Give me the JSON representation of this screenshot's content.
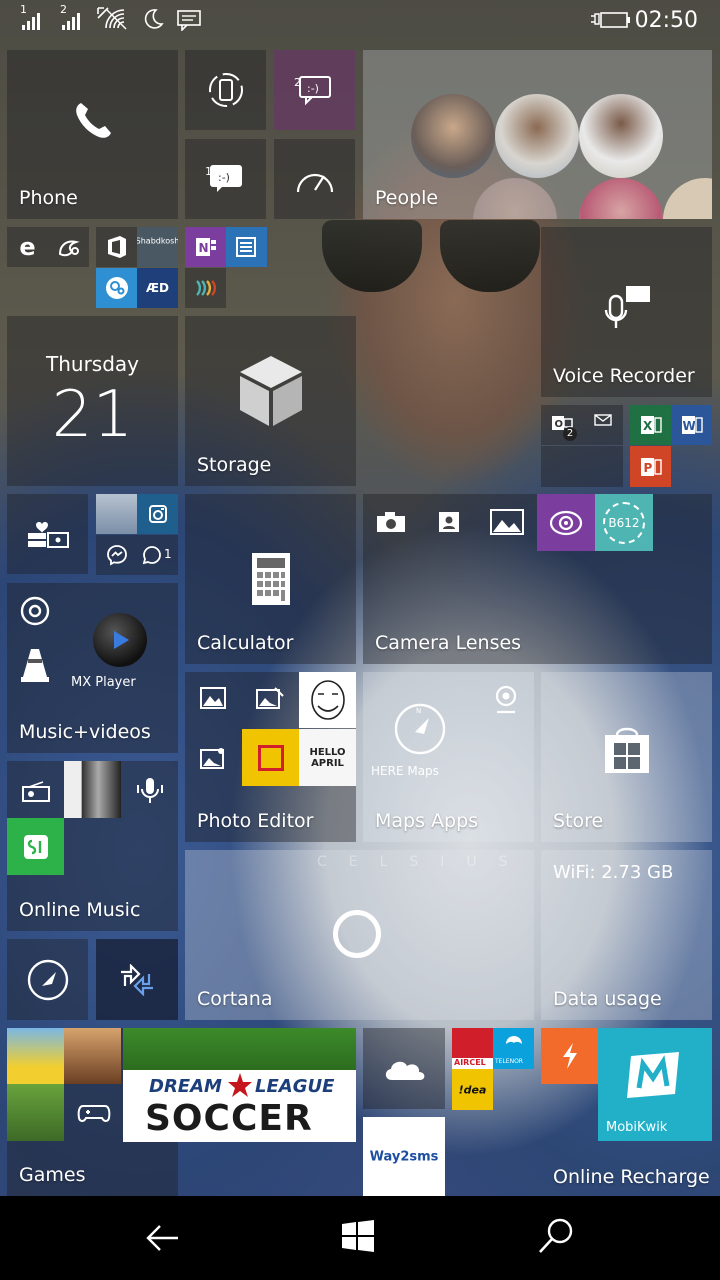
{
  "status_bar": {
    "sim1": "1",
    "sim2": "2",
    "time": "02:50"
  },
  "tiles": {
    "phone": {
      "label": "Phone"
    },
    "messaging_2": {
      "count": "2"
    },
    "messaging_1": {
      "count": "1"
    },
    "people": {
      "label": "People"
    },
    "shabdkosh": {
      "label": "Shabdkosh"
    },
    "aed": {
      "label": "ÆD"
    },
    "calendar": {
      "day_name": "Thursday",
      "day_number": "21"
    },
    "storage": {
      "label": "Storage"
    },
    "voice_recorder": {
      "label": "Voice Recorder"
    },
    "outlook_badge": {
      "count": "2"
    },
    "whatsapp_badge": {
      "count": "1"
    },
    "b612": {
      "label": "B612"
    },
    "calculator": {
      "label": "Calculator"
    },
    "camera_lenses": {
      "label": "Camera Lenses"
    },
    "mx_player": {
      "label": "MX Player"
    },
    "music_videos": {
      "label": "Music+videos"
    },
    "photo_editor": {
      "label": "Photo Editor"
    },
    "hello_april": {
      "label": "HELLO APRIL"
    },
    "maps_apps": {
      "label": "Maps Apps",
      "sub": "HERE Maps"
    },
    "store": {
      "label": "Store"
    },
    "online_music": {
      "label": "Online Music"
    },
    "data_usage": {
      "label": "Data usage",
      "info": "WiFi: 2.73 GB",
      "watermark": "CELSIUS"
    },
    "cortana": {
      "label": "Cortana"
    },
    "games": {
      "label": "Games"
    },
    "dream_league": {
      "line1": "DREAM",
      "line2": "LEAGUE",
      "line3": "SOCCER"
    },
    "aircel": {
      "label": "AIRCEL"
    },
    "telenor": {
      "label": "TELENOR"
    },
    "idea": {
      "label": "!dea"
    },
    "way2sms": {
      "label": "Way2sms"
    },
    "mobikwik": {
      "label": "MobiKwik"
    },
    "online_recharge": {
      "label": "Online Recharge"
    }
  },
  "colors": {
    "onenote": "#7b3e9f",
    "outlook_dark": "#1c3c7a",
    "excel": "#1f7144",
    "word": "#2b579a",
    "powerpoint": "#d04526",
    "instagram": "#1e5f8e",
    "purple": "#7b3e9f",
    "teal": "#4fb5b2",
    "saavn": "#2db24a",
    "yellow": "#f0c400",
    "aircel_red": "#d01f2b",
    "telenor_blue": "#0aa1dd",
    "mobikwik": "#22b0c8",
    "recharge_orange": "#f26b2a"
  },
  "navigation": {
    "back": "back-arrow-icon",
    "start": "windows-logo-icon",
    "search": "search-icon"
  }
}
